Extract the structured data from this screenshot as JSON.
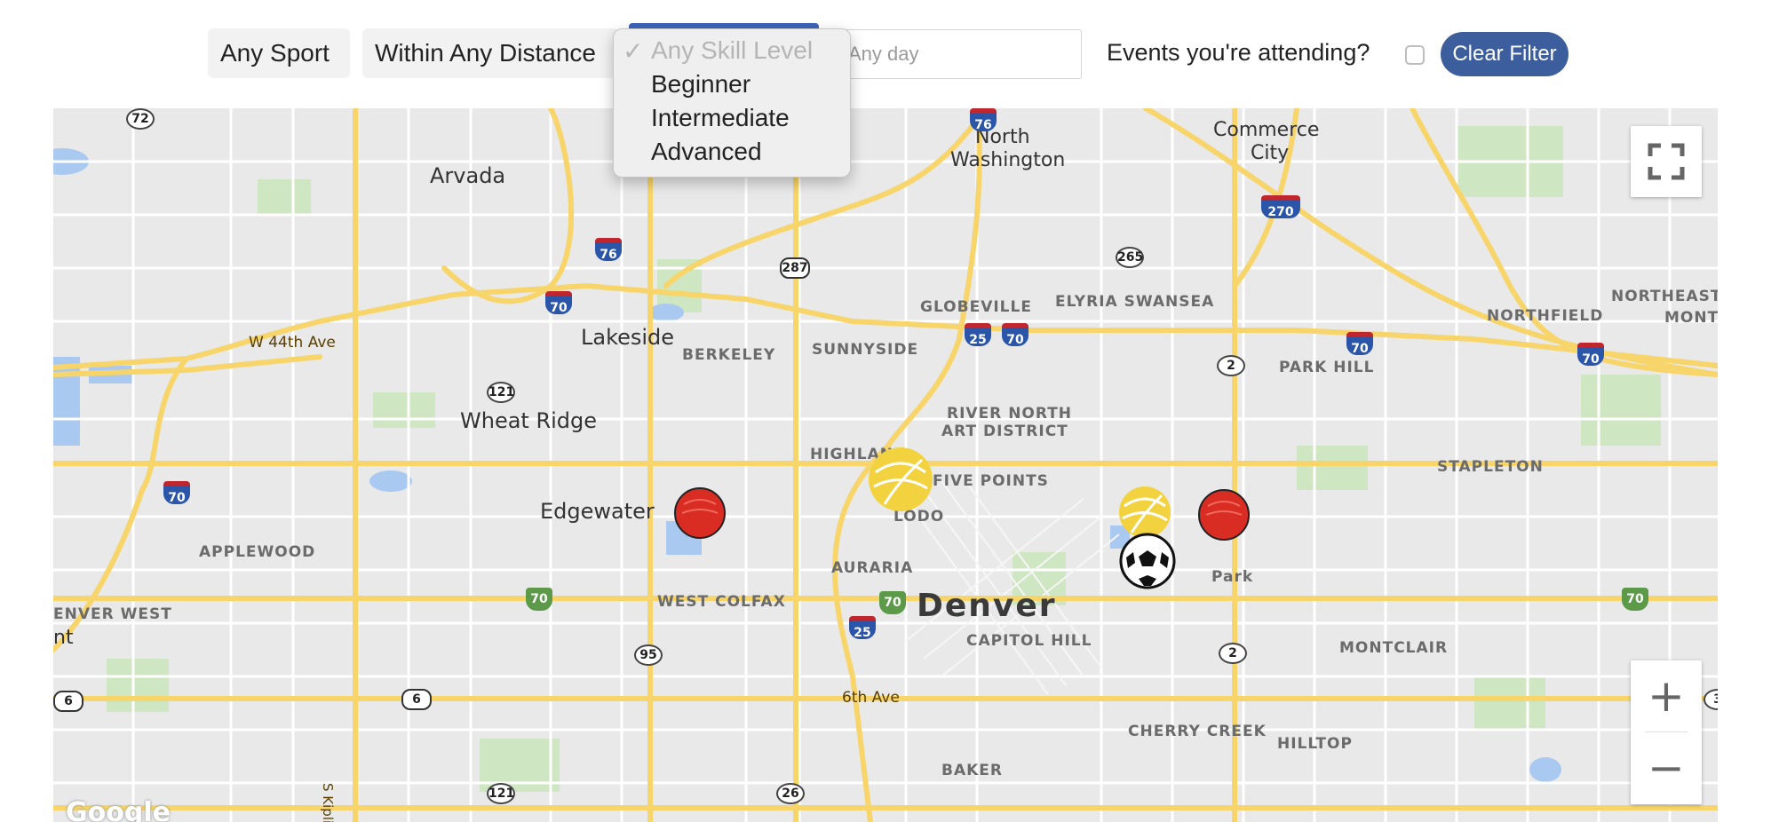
{
  "filters": {
    "sport": "Any Sport",
    "distance": "Within Any Distance",
    "date_placeholder": "Any day",
    "attending_label": "Events you're attending?",
    "clear_button": "Clear Filter"
  },
  "skill_dropdown": {
    "selected": "Any Skill Level",
    "options": [
      "Any Skill Level",
      "Beginner",
      "Intermediate",
      "Advanced"
    ]
  },
  "map": {
    "cities": [
      "Arvada",
      "Lakeside",
      "Wheat Ridge",
      "Edgewater",
      "Denver",
      "North",
      "Washington",
      "Commerce",
      "City",
      "Park"
    ],
    "neighborhoods": [
      "BERKELEY",
      "SUNNYSIDE",
      "GLOBEVILLE",
      "ELYRIA SWANSEA",
      "NORTHFIELD",
      "NORTHEAST",
      "MONT",
      "PARK HILL",
      "RIVER NORTH",
      "ART DISTRICT",
      "HIGHLAND",
      "FIVE POINTS",
      "LODO",
      "STAPLETON",
      "APPLEWOOD",
      "AURARIA",
      "WEST COLFAX",
      "ENVER WEST",
      "nt",
      "CAPITOL HILL",
      "MONTCLAIR",
      "CHERRY CREEK",
      "HILLTOP",
      "BAKER"
    ],
    "streets": [
      "W 44th Ave",
      "6th Ave",
      "S Kipli"
    ],
    "interstate_shields": [
      "76",
      "70",
      "25",
      "270",
      "76"
    ],
    "us_shields": [
      "287",
      "6",
      "6"
    ],
    "state_shields": [
      "72",
      "121",
      "121",
      "95",
      "265",
      "2",
      "2",
      "26",
      "3"
    ],
    "attribution": "Google",
    "markers": [
      "dodgeball",
      "volleyball",
      "volleyball",
      "dodgeball",
      "soccer-ball"
    ],
    "colors": {
      "accent": "#3d5e9d",
      "road": "#f7d56a",
      "dodgeball": "#d92c22",
      "volleyball": "#f2d33f"
    }
  },
  "controls": {
    "fullscreen": "fullscreen-icon",
    "zoom_in": "+",
    "zoom_out": "−"
  }
}
